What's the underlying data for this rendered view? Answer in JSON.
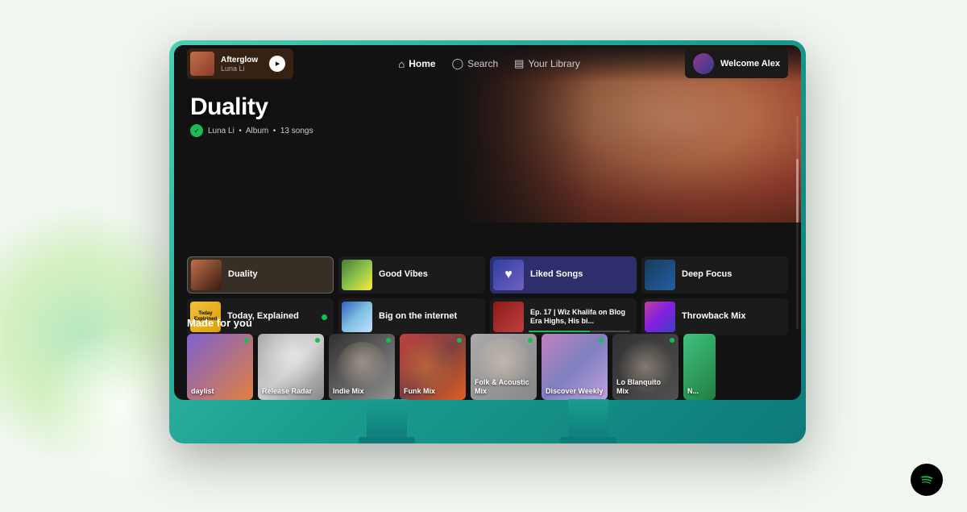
{
  "page": {
    "background": "#f0f7f0"
  },
  "navbar": {
    "now_playing": {
      "title": "Afterglow",
      "artist": "Luna Li"
    },
    "nav_items": [
      {
        "label": "Home",
        "icon": "🏠",
        "active": true
      },
      {
        "label": "Search",
        "icon": "🔍",
        "active": false
      },
      {
        "label": "Your Library",
        "icon": "📊",
        "active": false
      }
    ],
    "welcome": "Welcome Alex"
  },
  "hero": {
    "album_title": "Duality",
    "artist": "Luna Li",
    "type": "Album",
    "song_count": "13 songs"
  },
  "cards": [
    {
      "id": "duality",
      "label": "Duality",
      "selected": true
    },
    {
      "id": "good-vibes",
      "label": "Good Vibes",
      "selected": false
    },
    {
      "id": "liked-songs",
      "label": "Liked Songs",
      "selected": false
    },
    {
      "id": "deep-focus",
      "label": "Deep Focus",
      "selected": false
    },
    {
      "id": "today-explained",
      "label": "Today, Explained",
      "selected": false
    },
    {
      "id": "big-internet",
      "label": "Big on the internet",
      "selected": false
    },
    {
      "id": "podcast",
      "label": "Ep. 17 | Wiz Khalifa on Blog Era Highs, His bi...",
      "selected": false
    },
    {
      "id": "throwback-mix",
      "label": "Throwback Mix",
      "selected": false
    }
  ],
  "made_for_you": {
    "title": "Made for you",
    "items": [
      {
        "label": "daylist",
        "color1": "#8060d0",
        "color2": "#e08040"
      },
      {
        "label": "Release Radar",
        "color1": "#d0d0d0",
        "color2": "#808080"
      },
      {
        "label": "Indie Mix",
        "color1": "#404040",
        "color2": "#808080"
      },
      {
        "label": "Funk Mix",
        "color1": "#c04040",
        "color2": "#804040"
      },
      {
        "label": "Folk & Acoustic Mix",
        "color1": "#808040",
        "color2": "#c0c040"
      },
      {
        "label": "Discover Weekly",
        "color1": "#8080c0",
        "color2": "#c080c0"
      },
      {
        "label": "Lo Blanquito Mix",
        "color1": "#404040",
        "color2": "#808080"
      },
      {
        "label": "N...",
        "color1": "#40c080",
        "color2": "#208040"
      }
    ]
  }
}
